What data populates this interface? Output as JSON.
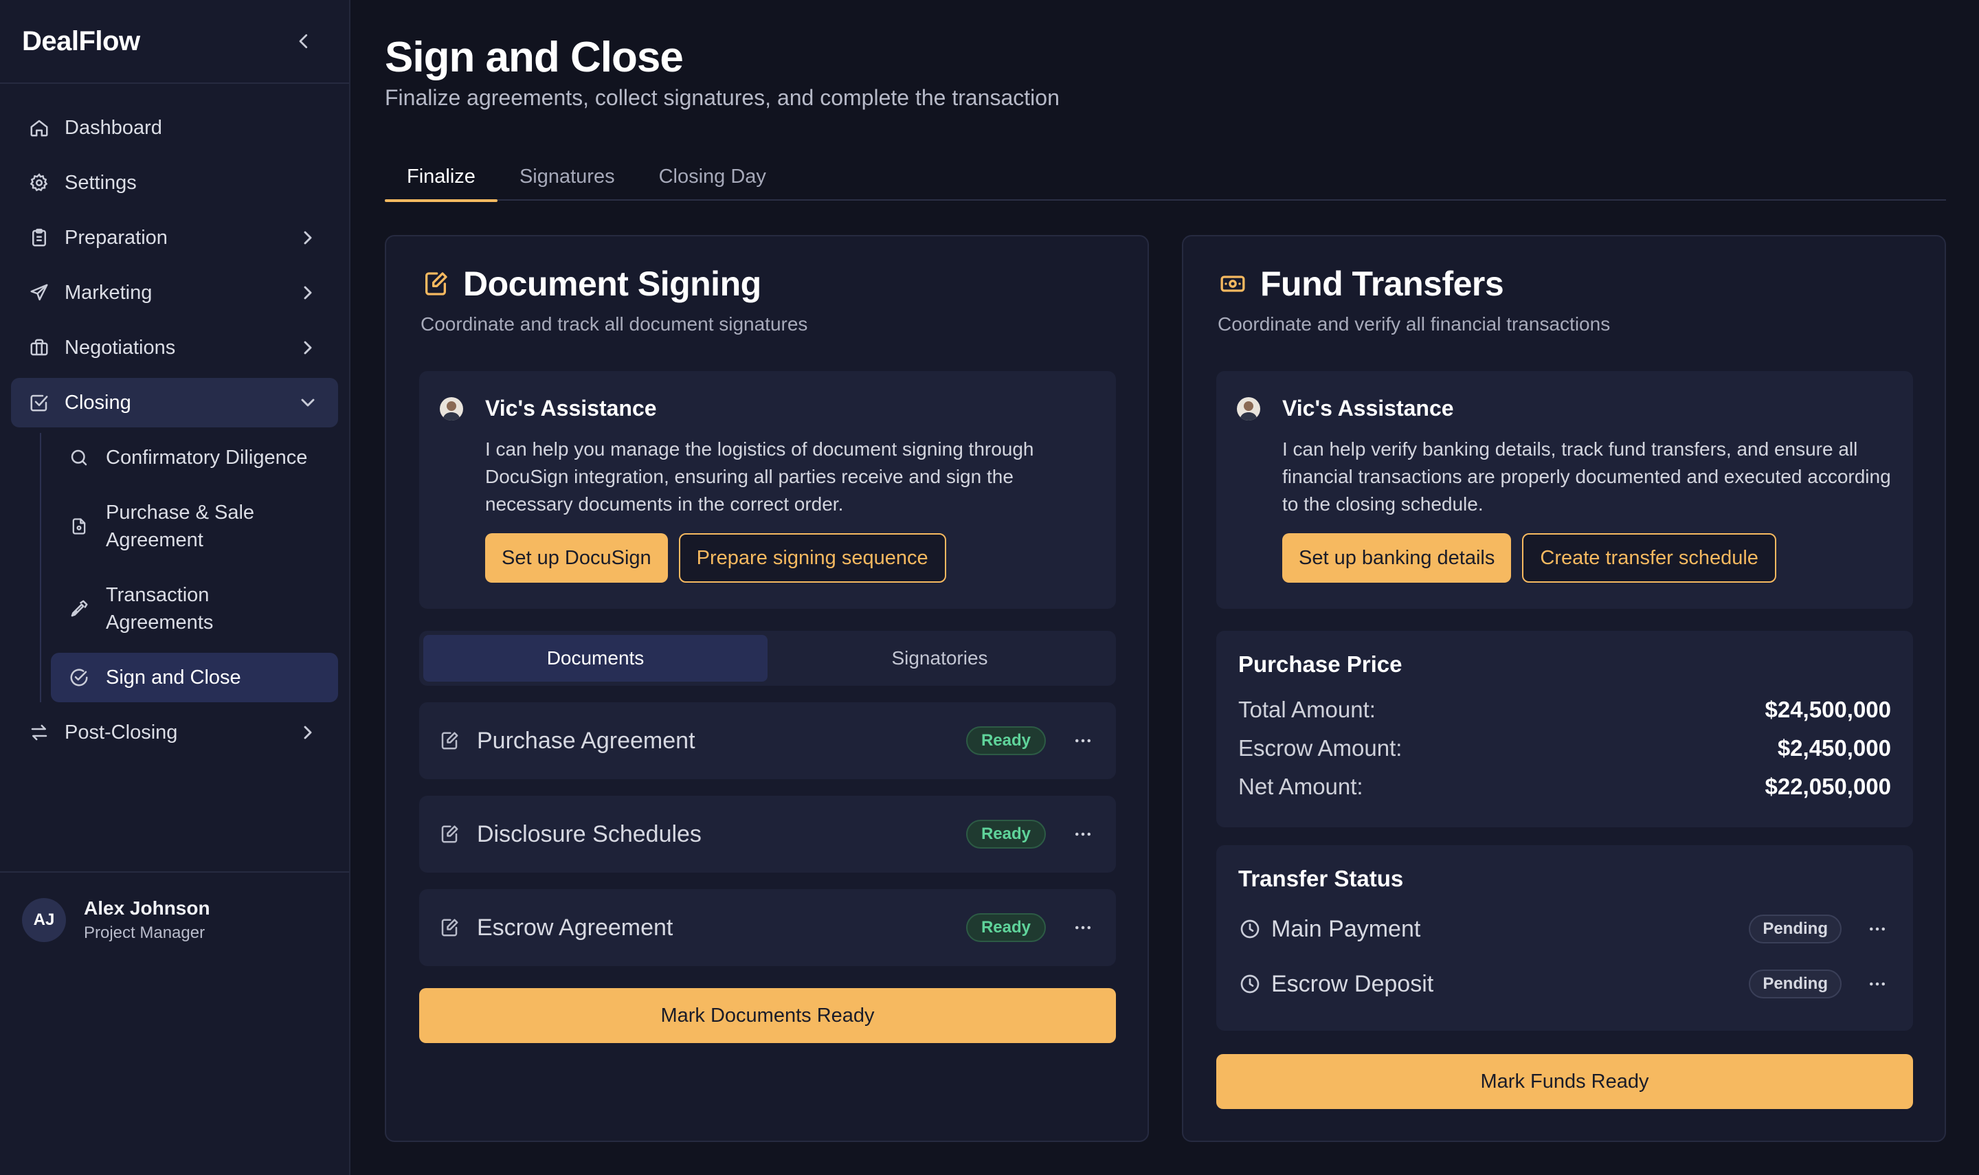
{
  "app": {
    "brand": "DealFlow"
  },
  "sidebar": {
    "items": [
      {
        "label": "Dashboard"
      },
      {
        "label": "Settings"
      },
      {
        "label": "Preparation"
      },
      {
        "label": "Marketing"
      },
      {
        "label": "Negotiations"
      },
      {
        "label": "Closing"
      },
      {
        "label": "Post-Closing"
      }
    ],
    "closing_sub": [
      {
        "label": "Confirmatory Diligence"
      },
      {
        "label": "Purchase & Sale Agreement"
      },
      {
        "label": "Transaction Agreements"
      },
      {
        "label": "Sign and Close"
      }
    ],
    "user": {
      "initials": "AJ",
      "name": "Alex Johnson",
      "role": "Project Manager"
    }
  },
  "page": {
    "title": "Sign and Close",
    "subtitle": "Finalize agreements, collect signatures, and complete the transaction",
    "tabs": [
      {
        "label": "Finalize"
      },
      {
        "label": "Signatures"
      },
      {
        "label": "Closing Day"
      }
    ]
  },
  "doc_signing": {
    "title": "Document Signing",
    "subtitle": "Coordinate and track all document signatures",
    "assist": {
      "title": "Vic's Assistance",
      "text": "I can help you manage the logistics of document signing through DocuSign integration, ensuring all parties receive and sign the necessary documents in the correct order.",
      "btn_primary": "Set up DocuSign",
      "btn_secondary": "Prepare signing sequence"
    },
    "segments": [
      {
        "label": "Documents"
      },
      {
        "label": "Signatories"
      }
    ],
    "documents": [
      {
        "name": "Purchase Agreement",
        "status": "Ready"
      },
      {
        "name": "Disclosure Schedules",
        "status": "Ready"
      },
      {
        "name": "Escrow Agreement",
        "status": "Ready"
      }
    ],
    "action": "Mark Documents Ready"
  },
  "fund_transfers": {
    "title": "Fund Transfers",
    "subtitle": "Coordinate and verify all financial transactions",
    "assist": {
      "title": "Vic's Assistance",
      "text": "I can help verify banking details, track fund transfers, and ensure all financial transactions are properly documented and executed according to the closing schedule.",
      "btn_primary": "Set up banking details",
      "btn_secondary": "Create transfer schedule"
    },
    "purchase_price": {
      "title": "Purchase Price",
      "rows": [
        {
          "label": "Total Amount:",
          "value": "$24,500,000"
        },
        {
          "label": "Escrow Amount:",
          "value": "$2,450,000"
        },
        {
          "label": "Net Amount:",
          "value": "$22,050,000"
        }
      ]
    },
    "transfer_status": {
      "title": "Transfer Status",
      "rows": [
        {
          "name": "Main Payment",
          "status": "Pending"
        },
        {
          "name": "Escrow Deposit",
          "status": "Pending"
        }
      ]
    },
    "action": "Mark Funds Ready"
  },
  "colors": {
    "accent": "#f6b960",
    "background": "#11131f",
    "panel": "#1e2238",
    "success": "#5fd39a"
  }
}
